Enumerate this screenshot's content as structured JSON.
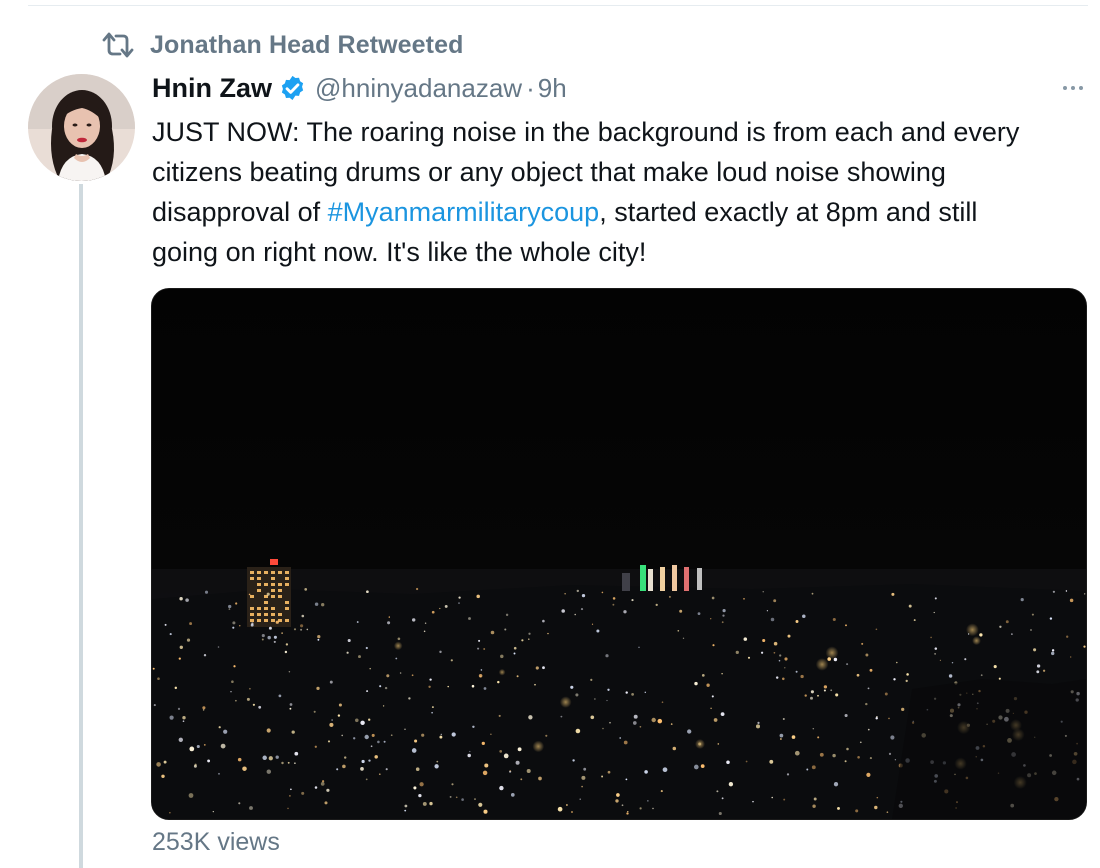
{
  "retweet": {
    "icon": "retweet-icon",
    "label": "Jonathan Head Retweeted"
  },
  "tweet": {
    "author": {
      "display_name": "Hnin Zaw",
      "handle": "@hninyadanazaw",
      "verified": true,
      "avatar_icon": "avatar-photo"
    },
    "separator": "·",
    "timestamp": "9h",
    "more_icon": "more-options-icon",
    "text": {
      "line1": "JUST NOW: The roaring noise in the background is from each and every",
      "line2": "citizens beating drums or any object that make loud noise showing",
      "line3_before": "disapproval of ",
      "hashtag": "#Myanmarmilitarycoup",
      "line3_after": ", started exactly at 8pm and still",
      "line4": "going on right now. It's like the whole city!"
    },
    "media": {
      "type": "video",
      "description_icon": "night-city-video"
    },
    "views": "253K views"
  },
  "colors": {
    "secondary_text": "#657786",
    "link": "#1b95e0",
    "verified": "#1da1f2",
    "thread_line": "#cfd9de",
    "media_bg": "#040404"
  }
}
